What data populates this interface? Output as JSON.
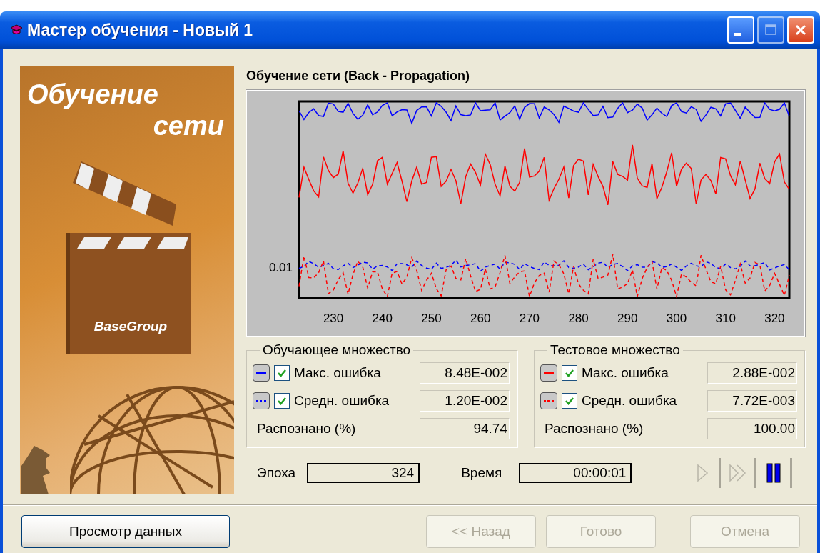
{
  "window": {
    "title": "Мастер обучения - Новый 1",
    "controls": [
      {
        "kind": "minimize",
        "disabled": false
      },
      {
        "kind": "maximize",
        "disabled": true
      },
      {
        "kind": "close",
        "disabled": false
      }
    ]
  },
  "banner": {
    "title_lines": [
      "Обучение",
      "сети"
    ],
    "logo_text": "BaseGroup"
  },
  "heading": "Обучение сети (Back - Propagation)",
  "chart": {
    "y_tick_label": "0.01",
    "x_tick_labels": [
      "230",
      "240",
      "250",
      "260",
      "270",
      "280",
      "290",
      "300",
      "310",
      "320"
    ]
  },
  "groups": [
    {
      "title": "Обучающее множество",
      "rows": [
        {
          "kind": "solid",
          "color": "#0000ff",
          "checked": true,
          "label": "Макс. ошибка",
          "value": "8.48E-002"
        },
        {
          "kind": "dashed",
          "color": "#0000ff",
          "checked": true,
          "label": "Средн. ошибка",
          "value": "1.20E-002"
        }
      ],
      "recognized": {
        "label": "Распознано (%)",
        "value": "94.74"
      }
    },
    {
      "title": "Тестовое множество",
      "rows": [
        {
          "kind": "solid",
          "color": "#ff0000",
          "checked": true,
          "label": "Макс. ошибка",
          "value": "2.88E-002"
        },
        {
          "kind": "dashed",
          "color": "#ff0000",
          "checked": true,
          "label": "Средн. ошибка",
          "value": "7.72E-003"
        }
      ],
      "recognized": {
        "label": "Распознано (%)",
        "value": "100.00"
      }
    }
  ],
  "epoch": {
    "label": "Эпоха",
    "value": "324"
  },
  "time": {
    "label": "Время",
    "value": "00:00:01"
  },
  "playback": [
    {
      "kind": "play",
      "disabled": true
    },
    {
      "kind": "step",
      "disabled": true
    },
    {
      "kind": "pause",
      "disabled": false
    }
  ],
  "buttons": [
    {
      "label": "Просмотр данных",
      "disabled": false
    },
    {
      "label": "<< Назад",
      "disabled": true
    },
    {
      "label": "Готово",
      "disabled": true
    },
    {
      "label": "Отмена",
      "disabled": true
    }
  ]
}
